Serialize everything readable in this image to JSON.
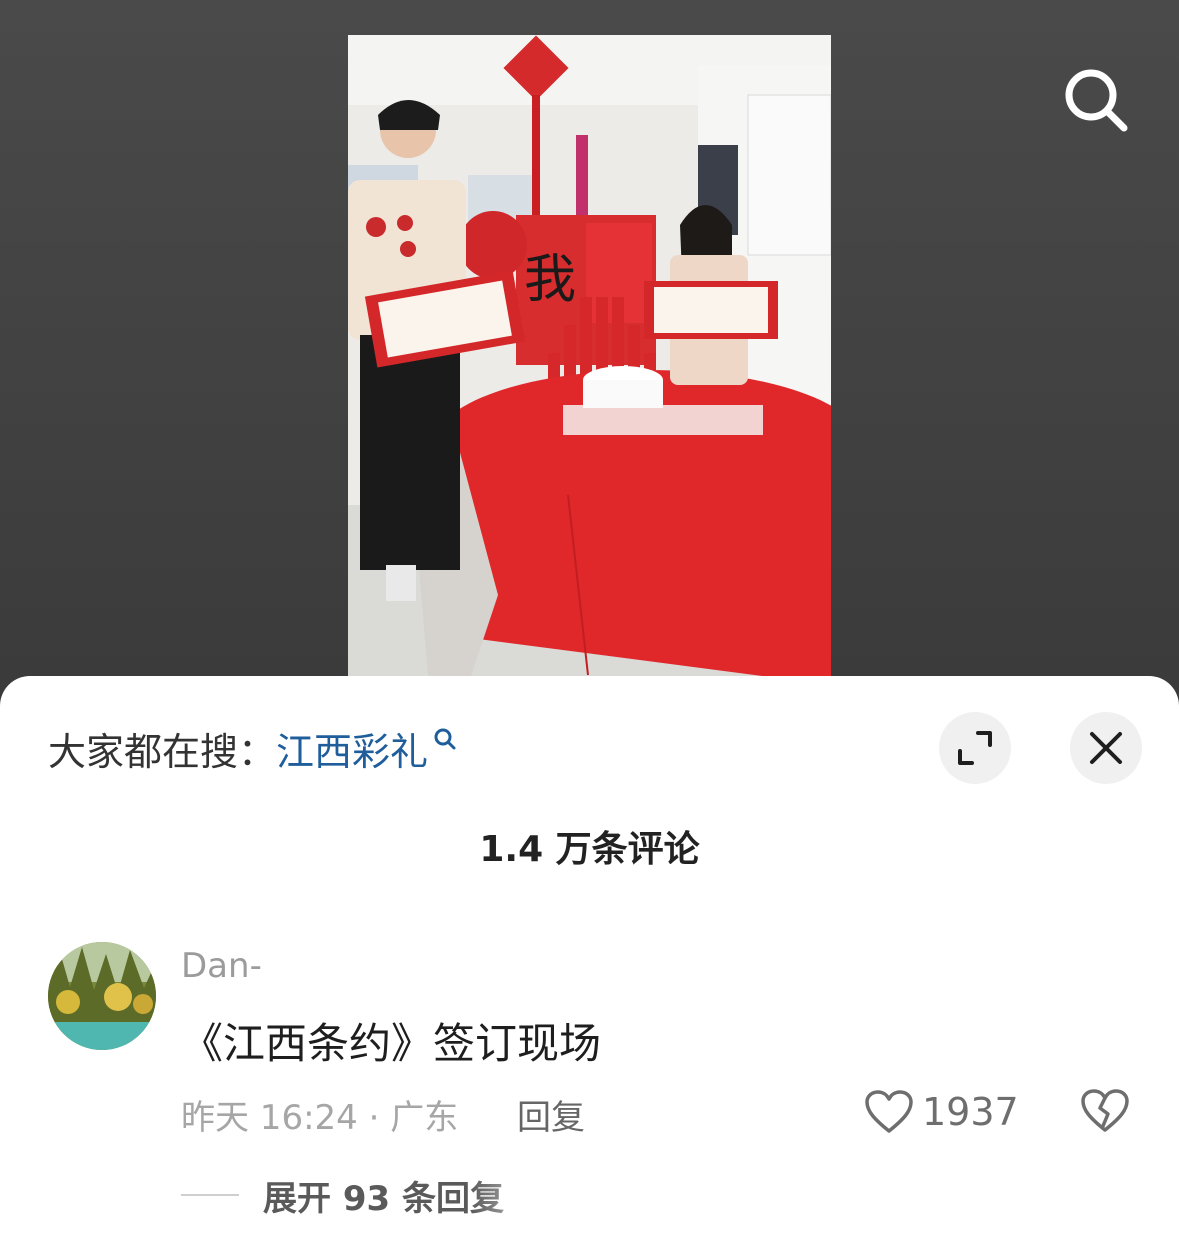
{
  "hot_search": {
    "prefix": "大家都在搜：",
    "term": "江西彩礼"
  },
  "comments_header": {
    "count_label": "1.4 万条评论"
  },
  "comment": {
    "username": "Dan-",
    "text": "《江西条约》签订现场",
    "meta": "昨天 16:24 · 广东",
    "reply_label": "回复",
    "like_count": "1937",
    "expand_label": "展开 93 条回复"
  },
  "icons": {
    "search": "search-icon",
    "expand": "expand-icon",
    "close": "close-icon",
    "like": "heart-icon",
    "dislike": "broken-heart-icon"
  },
  "colors": {
    "hot_term": "#1f5e9b",
    "tablecloth": "#e0282b",
    "sheet_bg": "#ffffff"
  }
}
